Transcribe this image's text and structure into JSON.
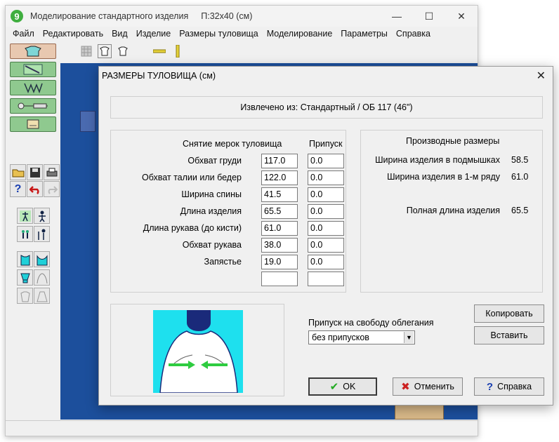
{
  "window": {
    "title": "Моделирование стандартного изделия",
    "size_label": "П:32х40  (см)",
    "minimize": "—",
    "maximize": "☐",
    "close": "✕"
  },
  "menu": [
    "Файл",
    "Редактировать",
    "Вид",
    "Изделие",
    "Размеры туловища",
    "Моделирование",
    "Параметры",
    "Справка"
  ],
  "dialog": {
    "title": "РАЗМЕРЫ ТУЛОВИЩА (см)",
    "close": "✕",
    "source_label": "Извлечено из:  Стандартный / ОБ 117 (46\")",
    "measurements_header": "Снятие мерок туловища",
    "allowance_header": "Припуск",
    "measurements": [
      {
        "label": "Обхват груди",
        "value": "117.0",
        "allowance": "0.0"
      },
      {
        "label": "Обхват талии или бедер",
        "value": "122.0",
        "allowance": "0.0"
      },
      {
        "label": "Ширина спины",
        "value": "41.5",
        "allowance": "0.0"
      },
      {
        "label": "Длина изделия",
        "value": "65.5",
        "allowance": "0.0"
      },
      {
        "label": "Длина рукава (до кисти)",
        "value": "61.0",
        "allowance": "0.0"
      },
      {
        "label": "Обхват рукава",
        "value": "38.0",
        "allowance": "0.0"
      },
      {
        "label": "Запястье",
        "value": "19.0",
        "allowance": "0.0"
      },
      {
        "label": "",
        "value": "",
        "allowance": ""
      }
    ],
    "derived_header": "Производные размеры",
    "derived": [
      {
        "label": "Ширина изделия в подмышках",
        "value": "58.5"
      },
      {
        "label": "Ширина изделия в 1-м ряду",
        "value": "61.0"
      },
      {
        "label": "Полная длина изделия",
        "value": "65.5"
      }
    ],
    "ease_label": "Припуск на свободу облегания",
    "ease_value": "без припусков",
    "copy_button": "Копировать",
    "paste_button": "Вставить",
    "ok_button": "OK",
    "cancel_button": "Отменить",
    "help_button": "Справка"
  },
  "colors": {
    "canvas": "#1c4f9c",
    "figure_bg": "#1ee0ee",
    "arrow": "#2ecc40",
    "cancel_icon": "#cc2222",
    "ok_icon": "#22aa22"
  }
}
